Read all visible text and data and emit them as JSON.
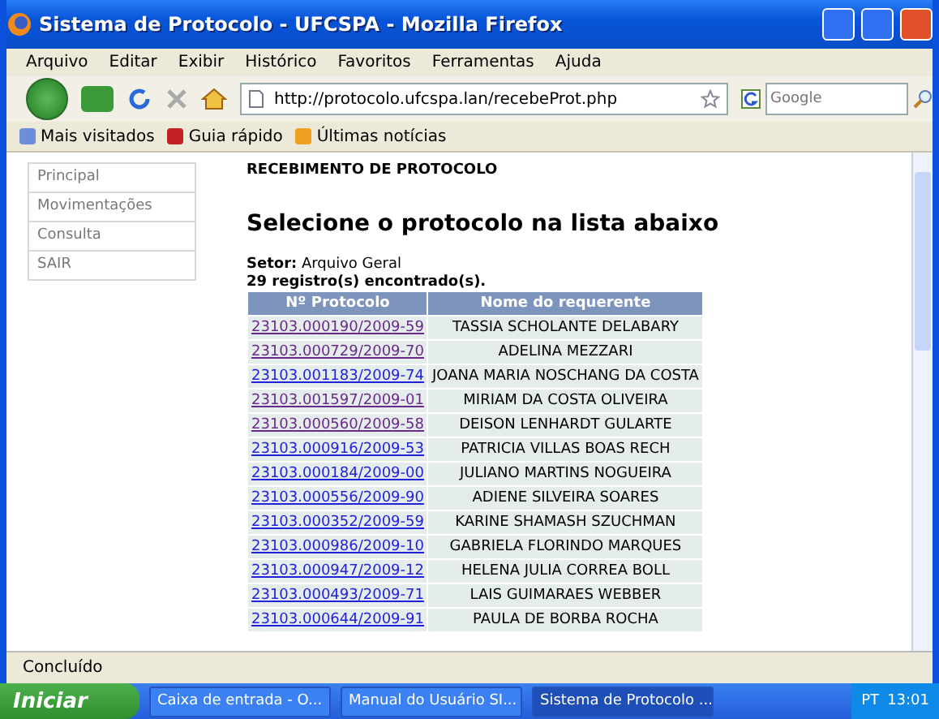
{
  "window": {
    "title": "Sistema de Protocolo - UFCSPA - Mozilla Firefox"
  },
  "menu": [
    "Arquivo",
    "Editar",
    "Exibir",
    "Histórico",
    "Favoritos",
    "Ferramentas",
    "Ajuda"
  ],
  "address": {
    "value": "http://protocolo.ufcspa.lan/recebeProt.php"
  },
  "search": {
    "placeholder": "Google"
  },
  "bookmarks": [
    "Mais visitados",
    "Guia rápido",
    "Últimas notícias"
  ],
  "sidebar": {
    "items": [
      "Principal",
      "Movimentações",
      "Consulta",
      "SAIR"
    ]
  },
  "page": {
    "section": "RECEBIMENTO DE PROTOCOLO",
    "heading": "Selecione o protocolo na lista abaixo",
    "setor_label": "Setor:",
    "setor_value": "Arquivo Geral",
    "count": "29 registro(s) encontrado(s)."
  },
  "table": {
    "columns": [
      "Nº Protocolo",
      "Nome do requerente"
    ],
    "rows": [
      {
        "protocol": "23103.000190/2009-59",
        "name": "TASSIA SCHOLANTE DELABARY",
        "visited": true
      },
      {
        "protocol": "23103.000729/2009-70",
        "name": "ADELINA MEZZARI",
        "visited": true
      },
      {
        "protocol": "23103.001183/2009-74",
        "name": "JOANA MARIA NOSCHANG DA COSTA",
        "visited": false
      },
      {
        "protocol": "23103.001597/2009-01",
        "name": "MIRIAM DA COSTA OLIVEIRA",
        "visited": true
      },
      {
        "protocol": "23103.000560/2009-58",
        "name": "DEISON LENHARDT GULARTE",
        "visited": true
      },
      {
        "protocol": "23103.000916/2009-53",
        "name": "PATRICIA VILLAS BOAS RECH",
        "visited": false
      },
      {
        "protocol": "23103.000184/2009-00",
        "name": "JULIANO MARTINS NOGUEIRA",
        "visited": false
      },
      {
        "protocol": "23103.000556/2009-90",
        "name": "ADIENE SILVEIRA SOARES",
        "visited": false
      },
      {
        "protocol": "23103.000352/2009-59",
        "name": "KARINE SHAMASH SZUCHMAN",
        "visited": false
      },
      {
        "protocol": "23103.000986/2009-10",
        "name": "GABRIELA FLORINDO MARQUES",
        "visited": false
      },
      {
        "protocol": "23103.000947/2009-12",
        "name": "HELENA JULIA CORREA BOLL",
        "visited": false
      },
      {
        "protocol": "23103.000493/2009-71",
        "name": "LAIS GUIMARAES WEBBER",
        "visited": false
      },
      {
        "protocol": "23103.000644/2009-91",
        "name": "PAULA DE BORBA ROCHA",
        "visited": false
      }
    ]
  },
  "status_bar": "Concluído",
  "taskbar": {
    "start": "Iniciar",
    "tasks": [
      {
        "label": "Caixa de entrada - O...",
        "selected": false
      },
      {
        "label": "Manual do Usuário SI...",
        "selected": false
      },
      {
        "label": "Sistema de Protocolo ...",
        "selected": true
      }
    ],
    "language": "PT",
    "clock": "13:01"
  }
}
